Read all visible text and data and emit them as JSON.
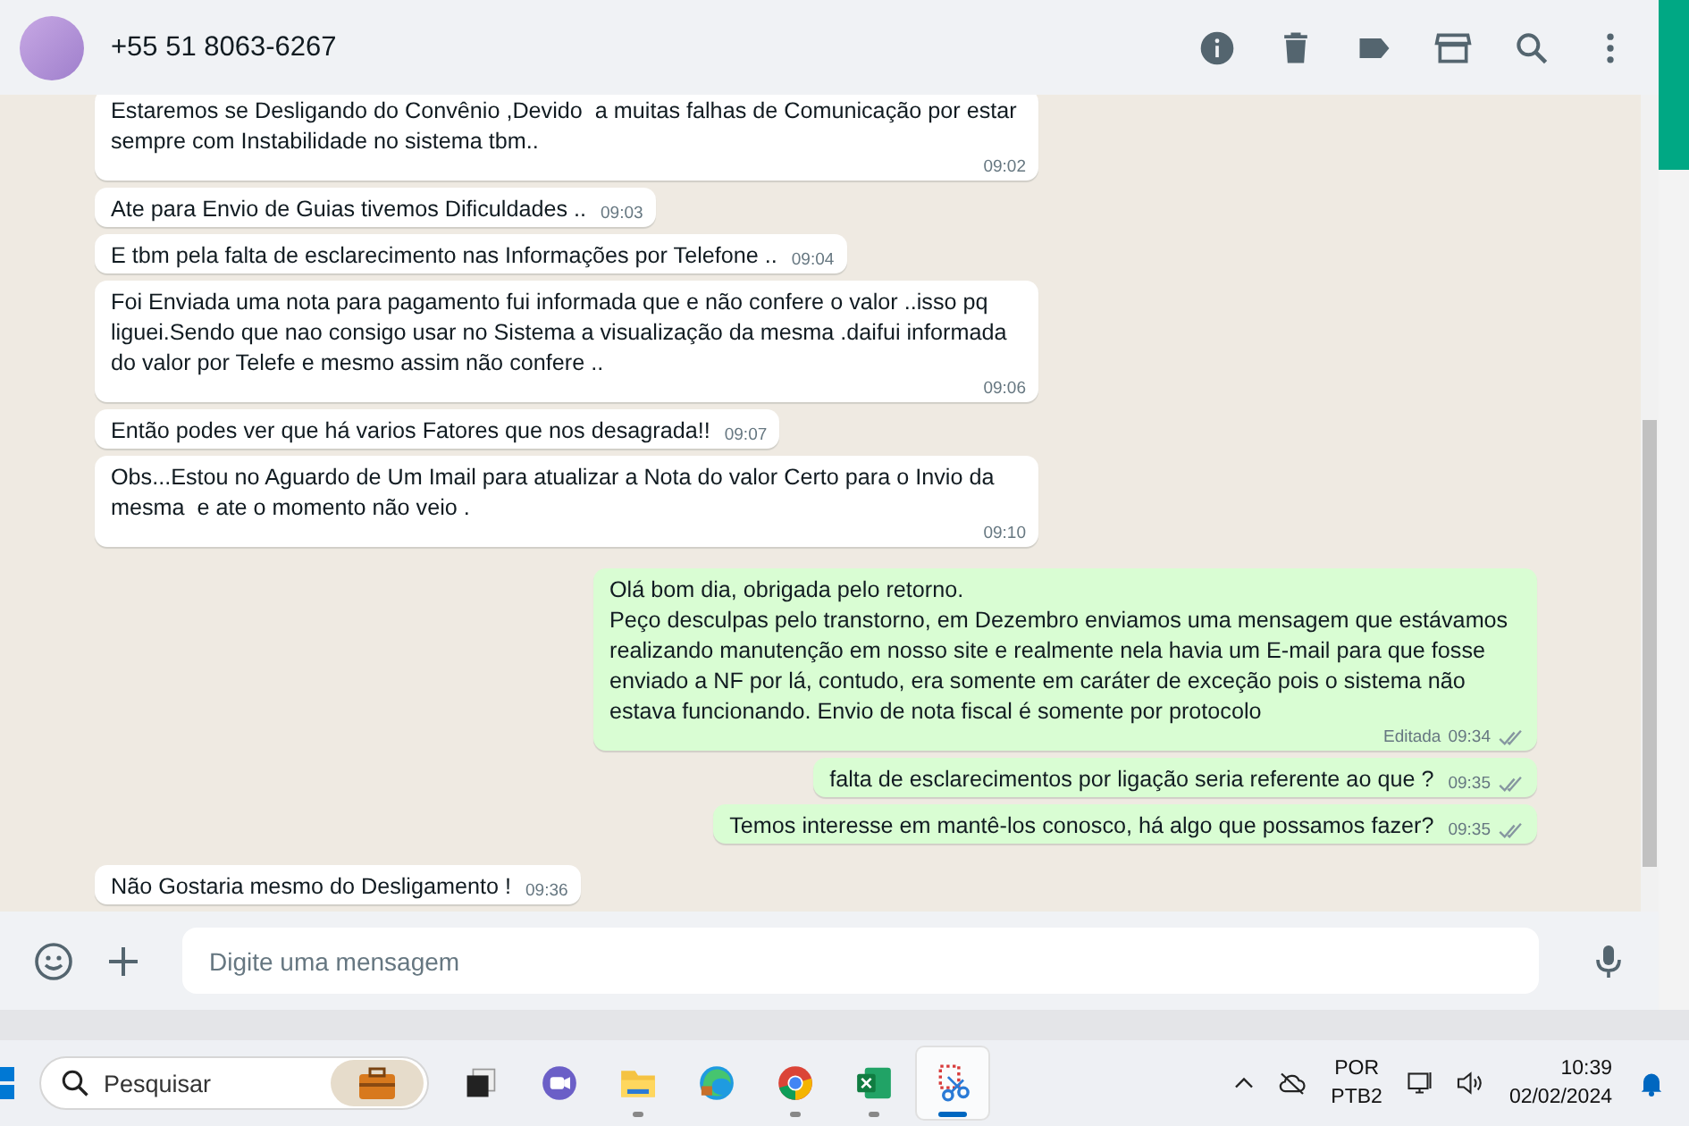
{
  "header": {
    "contact": "+55 51 8063-6267"
  },
  "messages": [
    {
      "kind": "in",
      "text": "Estaremos se Desligando do Convênio ,Devido  a muitas falhas de Comunicação por estar sempre com Instabilidade no sistema tbm..",
      "time": "09:02"
    },
    {
      "kind": "in",
      "text": "Ate para Envio de Guias tivemos Dificuldades ..",
      "time": "09:03"
    },
    {
      "kind": "in",
      "text": "E tbm pela falta de esclarecimento nas Informações por Telefone ..",
      "time": "09:04"
    },
    {
      "kind": "in",
      "text": "Foi Enviada uma nota para pagamento fui informada que e não confere o valor ..isso pq liguei.Sendo que nao consigo usar no Sistema a visualização da mesma .daifui informada do valor por Telefe e mesmo assim não confere ..",
      "time": "09:06"
    },
    {
      "kind": "in",
      "text": "Então podes ver que há varios Fatores que nos desagrada!!",
      "time": "09:07"
    },
    {
      "kind": "in",
      "text": "Obs...Estou no Aguardo de Um Imail para atualizar a Nota do valor Certo para o Invio da mesma  e ate o momento não veio .",
      "time": "09:10"
    },
    {
      "kind": "out",
      "text": "Olá bom dia, obrigada pelo retorno.\nPeço desculpas pelo transtorno, em Dezembro enviamos uma mensagem que estávamos realizando manutenção em nosso site e realmente nela havia um E-mail para que fosse enviado a NF por lá, contudo, era somente em caráter de exceção pois o sistema não estava funcionando. Envio de nota fiscal é somente por protocolo",
      "edited": "Editada",
      "time": "09:34",
      "read": false
    },
    {
      "kind": "out",
      "text": "falta de esclarecimentos por ligação seria referente ao que ?",
      "time": "09:35",
      "read": false
    },
    {
      "kind": "out",
      "text": "Temos interesse em mantê-los conosco, há algo que possamos fazer?",
      "time": "09:35",
      "read": false
    },
    {
      "kind": "in",
      "text": "Não Gostaria mesmo do Desligamento !",
      "time": "09:36"
    }
  ],
  "composer": {
    "placeholder": "Digite uma mensagem"
  },
  "taskbar": {
    "search": {
      "placeholder": "Pesquisar"
    },
    "apps": [
      {
        "kind": "task-view",
        "running": false,
        "selected": false
      },
      {
        "kind": "chat",
        "running": false,
        "selected": false
      },
      {
        "kind": "folder",
        "running": true,
        "selected": false
      },
      {
        "kind": "edge",
        "running": false,
        "selected": false
      },
      {
        "kind": "chrome",
        "running": true,
        "selected": false
      },
      {
        "kind": "excel",
        "running": true,
        "selected": false
      },
      {
        "kind": "snip",
        "running": true,
        "selected": true
      }
    ],
    "language": [
      "POR",
      "PTB2"
    ],
    "clock": {
      "time": "10:39",
      "date": "02/02/2024"
    }
  }
}
